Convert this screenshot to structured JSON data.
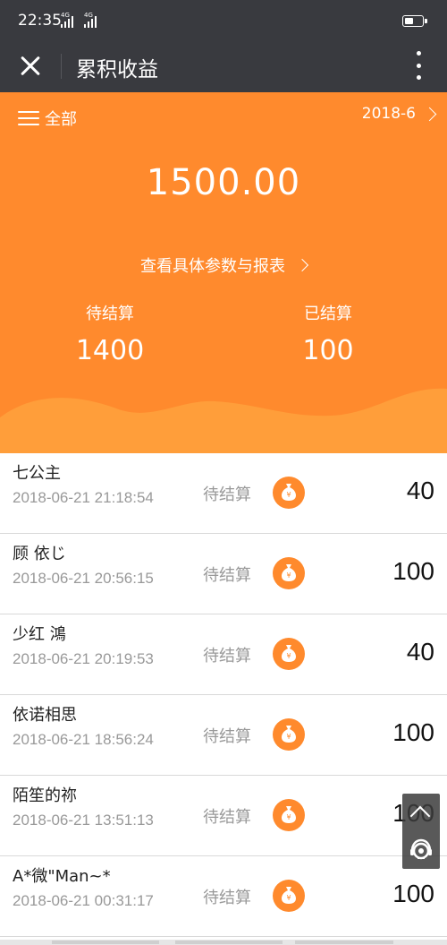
{
  "status_bar": {
    "time": "22:35",
    "network_1": "4G",
    "network_2": "4G",
    "battery_level": 0.55
  },
  "title_bar": {
    "title": "累积收益",
    "close_icon": "close-icon",
    "more_icon": "more-vertical-icon"
  },
  "header": {
    "filter_label": "全部",
    "month": "2018-6",
    "total": "1500.00",
    "report_link": "查看具体参数与报表",
    "pending_label": "待结算",
    "pending_value": "1400",
    "settled_label": "已结算",
    "settled_value": "100",
    "accent_color": "#ff8a2d"
  },
  "records": [
    {
      "name": "七公主",
      "time": "2018-06-21 21:18:54",
      "status": "待结算",
      "amount": "40"
    },
    {
      "name": "顾 依じ",
      "time": "2018-06-21 20:56:15",
      "status": "待结算",
      "amount": "100"
    },
    {
      "name": "少红 鴻",
      "time": "2018-06-21 20:19:53",
      "status": "待结算",
      "amount": "40"
    },
    {
      "name": "依诺相思",
      "time": "2018-06-21 18:56:24",
      "status": "待结算",
      "amount": "100"
    },
    {
      "name": "陌笙的祢",
      "time": "2018-06-21 13:51:13",
      "status": "待结算",
      "amount": "100"
    },
    {
      "name": "A*微\"Man~*",
      "time": "2018-06-21 00:31:17",
      "status": "待结算",
      "amount": "100"
    }
  ],
  "floating": {
    "top_icon": "chevron-up-icon",
    "service_icon": "customer-service-icon"
  }
}
